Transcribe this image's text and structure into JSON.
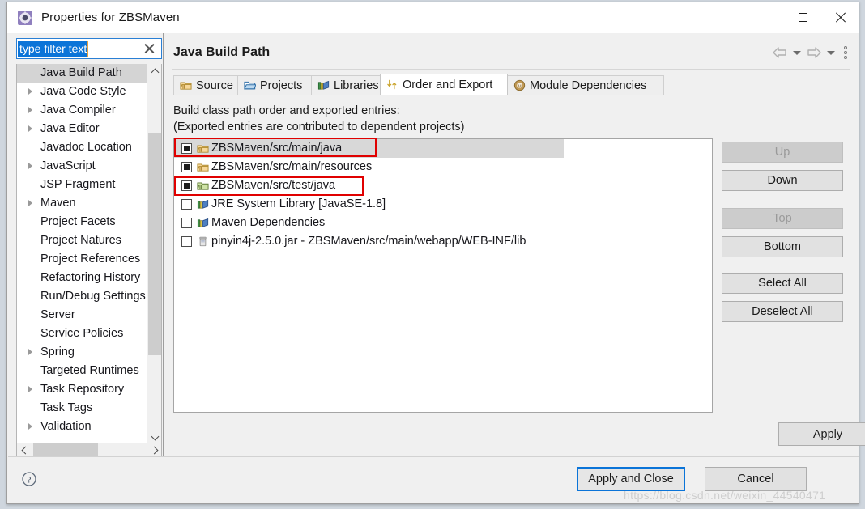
{
  "window": {
    "title": "Properties for ZBSMaven",
    "app_icon": "eclipse-properties-icon",
    "minimize_label": "Minimize",
    "maximize_label": "Maximize",
    "close_label": "Close"
  },
  "filter": {
    "value": "type filter text",
    "placeholder": "type filter text",
    "clear_label": "Clear"
  },
  "sidebar": {
    "items": [
      {
        "label": "Java Build Path",
        "expandable": false,
        "selected": true
      },
      {
        "label": "Java Code Style",
        "expandable": true,
        "selected": false
      },
      {
        "label": "Java Compiler",
        "expandable": true,
        "selected": false
      },
      {
        "label": "Java Editor",
        "expandable": true,
        "selected": false
      },
      {
        "label": "Javadoc Location",
        "expandable": false,
        "selected": false
      },
      {
        "label": "JavaScript",
        "expandable": true,
        "selected": false
      },
      {
        "label": "JSP Fragment",
        "expandable": false,
        "selected": false
      },
      {
        "label": "Maven",
        "expandable": true,
        "selected": false
      },
      {
        "label": "Project Facets",
        "expandable": false,
        "selected": false
      },
      {
        "label": "Project Natures",
        "expandable": false,
        "selected": false
      },
      {
        "label": "Project References",
        "expandable": false,
        "selected": false
      },
      {
        "label": "Refactoring History",
        "expandable": false,
        "selected": false
      },
      {
        "label": "Run/Debug Settings",
        "expandable": false,
        "selected": false
      },
      {
        "label": "Server",
        "expandable": false,
        "selected": false
      },
      {
        "label": "Service Policies",
        "expandable": false,
        "selected": false
      },
      {
        "label": "Spring",
        "expandable": true,
        "selected": false
      },
      {
        "label": "Targeted Runtimes",
        "expandable": false,
        "selected": false
      },
      {
        "label": "Task Repository",
        "expandable": true,
        "selected": false
      },
      {
        "label": "Task Tags",
        "expandable": false,
        "selected": false
      },
      {
        "label": "Validation",
        "expandable": true,
        "selected": false
      }
    ]
  },
  "page": {
    "title": "Java Build Path",
    "nav": {
      "back_label": "Back",
      "back_menu_label": "Back history",
      "forward_label": "Forward",
      "forward_menu_label": "Forward history",
      "menu_label": "View Menu"
    }
  },
  "tabs": [
    {
      "label": "Source",
      "icon": "source-folder-icon",
      "active": false
    },
    {
      "label": "Projects",
      "icon": "open-folder-icon",
      "active": false
    },
    {
      "label": "Libraries",
      "icon": "library-books-icon",
      "active": false
    },
    {
      "label": "Order and Export",
      "icon": "order-export-arrows-icon",
      "active": true
    },
    {
      "label": "Module Dependencies",
      "icon": "module-circle-icon",
      "active": false
    }
  ],
  "description": {
    "line1": "Build class path order and exported entries:",
    "line2": "(Exported entries are contributed to dependent projects)"
  },
  "entries": [
    {
      "label": "ZBSMaven/src/main/java",
      "checked": true,
      "icon": "source-folder-icon",
      "selected": true,
      "annotated": true
    },
    {
      "label": "ZBSMaven/src/main/resources",
      "checked": true,
      "icon": "source-folder-icon",
      "selected": false,
      "annotated": false
    },
    {
      "label": "ZBSMaven/src/test/java",
      "checked": true,
      "icon": "test-folder-icon",
      "selected": false,
      "annotated": true
    },
    {
      "label": "JRE System Library [JavaSE-1.8]",
      "checked": false,
      "icon": "library-books-icon",
      "selected": false,
      "annotated": false
    },
    {
      "label": "Maven Dependencies",
      "checked": false,
      "icon": "library-books-icon",
      "selected": false,
      "annotated": false
    },
    {
      "label": "pinyin4j-2.5.0.jar - ZBSMaven/src/main/webapp/WEB-INF/lib",
      "checked": false,
      "icon": "jar-icon",
      "selected": false,
      "annotated": false
    }
  ],
  "side_buttons": [
    {
      "label": "Up",
      "disabled": true
    },
    {
      "label": "Down",
      "disabled": false
    },
    {
      "label": "Top",
      "disabled": true
    },
    {
      "label": "Bottom",
      "disabled": false
    },
    {
      "label": "Select All",
      "disabled": false
    },
    {
      "label": "Deselect All",
      "disabled": false
    }
  ],
  "buttons": {
    "apply": "Apply",
    "apply_and_close": "Apply and Close",
    "cancel": "Cancel",
    "help_label": "Help"
  },
  "watermark": "https://blog.csdn.net/weixin_44540471",
  "colors": {
    "accent": "#0b74d8",
    "annotation": "#e00000",
    "dialog_bg": "#f0f0f0",
    "selection": "#d8d8d8"
  }
}
